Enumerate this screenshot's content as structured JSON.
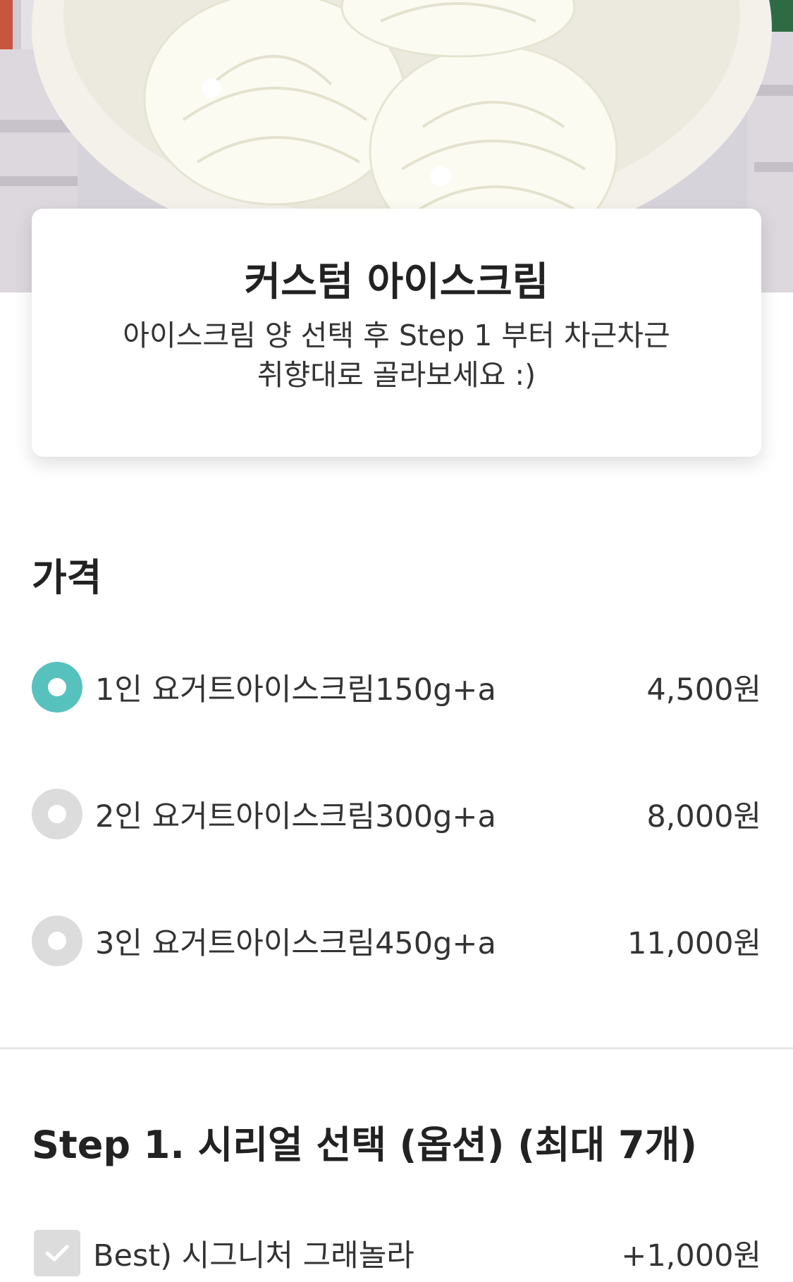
{
  "header": {
    "title": "커스텀 아이스크림",
    "subtitle": "아이스크림 양 선택 후 Step 1 부터 차근차근 취향대로 골라보세요 :)"
  },
  "price_section": {
    "title": "가격",
    "options": [
      {
        "label": "1인 요거트아이스크림150g+a",
        "price": "4,500원",
        "selected": true
      },
      {
        "label": "2인 요거트아이스크림300g+a",
        "price": "8,000원",
        "selected": false
      },
      {
        "label": "3인 요거트아이스크림450g+a",
        "price": "11,000원",
        "selected": false
      }
    ]
  },
  "step1": {
    "title": "Step 1. 시리얼 선택 (옵션) (최대 7개)",
    "options": [
      {
        "label": "Best) 시그니처 그래놀라",
        "price": "+1,000원",
        "checked": false
      }
    ]
  },
  "colors": {
    "accent": "#57c1be",
    "radio_unselected": "#dcdcdc",
    "divider": "#e6e6e6"
  }
}
